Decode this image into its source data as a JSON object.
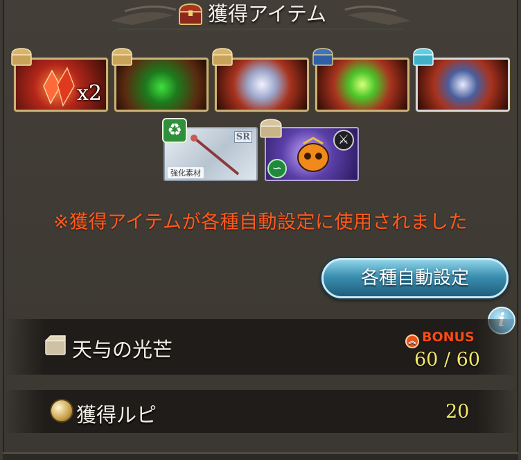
{
  "header": {
    "title": "獲得アイテム"
  },
  "items": [
    {
      "name": "crystal",
      "count": "x2",
      "chest": "gold"
    },
    {
      "name": "green-orb-item",
      "count": "",
      "chest": "gold"
    },
    {
      "name": "summon-orb-white",
      "count": "",
      "chest": "gold"
    },
    {
      "name": "green-orb",
      "count": "",
      "chest": "blue"
    },
    {
      "name": "summon-orb-dark",
      "count": "",
      "chest": "cyan"
    }
  ],
  "cards": {
    "weapon_rarity": "SR",
    "weapon_label": "強化素材"
  },
  "notice": "※獲得アイテムが各種自動設定に使用されました",
  "auto_button": "各種自動設定",
  "rows": {
    "tenyo": {
      "label": "天与の光芒",
      "bonus": "BONUS",
      "value": "60 / 60"
    },
    "rupie": {
      "label": "獲得ルピ",
      "value": "20"
    }
  },
  "colors": {
    "notice": "#ff5a1e",
    "value": "#f3e86a",
    "button": "#3b8fb0"
  }
}
